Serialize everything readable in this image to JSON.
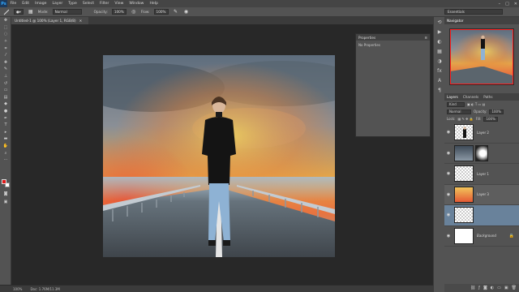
{
  "app": {
    "logo": "Ps",
    "menu": [
      "File",
      "Edit",
      "Image",
      "Layer",
      "Type",
      "Select",
      "Filter",
      "View",
      "Window",
      "Help"
    ],
    "window_controls": [
      "–",
      "□",
      "✕"
    ]
  },
  "options": {
    "mode_label": "Mode:",
    "mode_value": "Normal",
    "opacity_label": "Opacity:",
    "opacity_value": "100%",
    "flow_label": "Flow:",
    "flow_value": "100%",
    "workspace": "Essentials"
  },
  "document": {
    "tab_title": "Untitled-1 @ 100% (Layer 1, RGB/8)",
    "zoom": "100%",
    "doc_info": "Doc: 1.76M/11.3M"
  },
  "properties": {
    "title": "Properties",
    "body": "No Properties"
  },
  "navigator": {
    "title": "Navigator"
  },
  "layers_panel": {
    "tabs": [
      "Layers",
      "Channels",
      "Paths"
    ],
    "filter_label": "Kind",
    "blend_mode": "Normal",
    "opacity_label": "Opacity:",
    "opacity_value": "100%",
    "lock_label": "Lock:",
    "fill_label": "Fill:",
    "fill_value": "100%",
    "layers": [
      {
        "name": "Layer 2",
        "selected": false
      },
      {
        "name": "",
        "selected": false
      },
      {
        "name": "Layer 1",
        "selected": false
      },
      {
        "name": "Layer 3",
        "selected": false
      },
      {
        "name": "",
        "selected": true
      },
      {
        "name": "Background",
        "selected": false
      }
    ]
  },
  "colors": {
    "foreground": "#e01a1a",
    "background": "#ffffff",
    "selection": "#69829b",
    "ui_panel": "#535353"
  }
}
